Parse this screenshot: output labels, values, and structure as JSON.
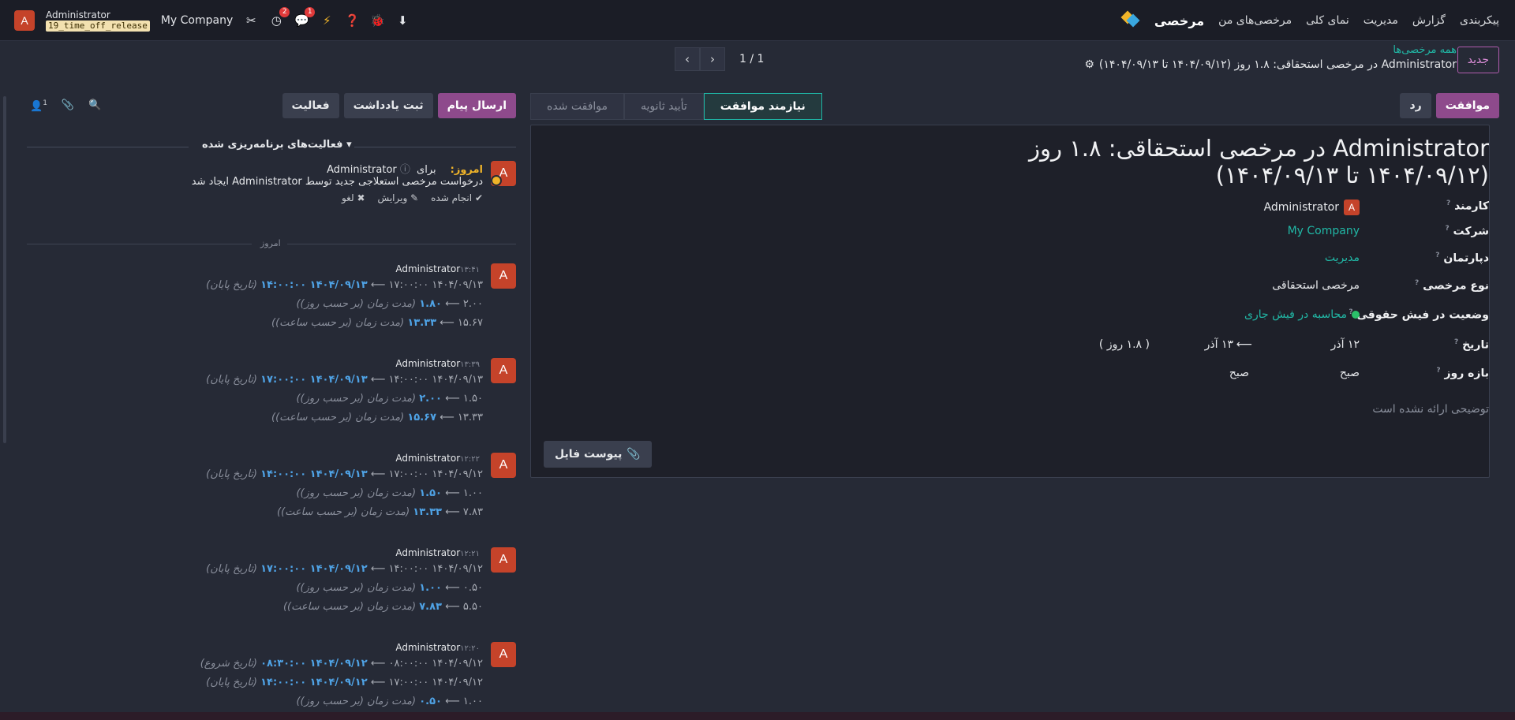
{
  "navbar": {
    "app_name": "مرخصی",
    "menu": [
      "مرخصی‌های من",
      "نمای کلی",
      "مدیریت",
      "گزارش",
      "پیکربندی"
    ],
    "company": "My Company",
    "user_name": "Administrator",
    "db_name": "19_time_off_release",
    "avatar_letter": "A",
    "activity_badge": "2",
    "chat_badge": "1"
  },
  "control": {
    "new_label": "جدید",
    "breadcrumb_parent": "همه مرخصی‌ها",
    "breadcrumb_current": "Administrator در مرخصی استحقاقی: ۱.۸ روز (۱۴۰۴/۰۹/۱۲ تا ۱۴۰۴/۰۹/۱۳)",
    "pager_value": "1 / 1"
  },
  "status": {
    "approve_label": "موافقت",
    "refuse_label": "رد",
    "stages": [
      {
        "label": "نیازمند موافقت",
        "active": true
      },
      {
        "label": "تأیید ثانویه",
        "active": false
      },
      {
        "label": "موافقت شده",
        "active": false
      }
    ]
  },
  "form": {
    "title": "Administrator در مرخصی استحقاقی: ۱.۸ روز (۱۴۰۴/۰۹/۱۲ تا ۱۴۰۴/۰۹/۱۳)",
    "employee_label": "کارمند",
    "employee_value": "Administrator",
    "company_label": "شرکت",
    "company_value": "My Company",
    "department_label": "دپارتمان",
    "department_value": "مدیریت",
    "leave_type_label": "نوع مرخصی",
    "leave_type_value": "مرخصی استحقاقی",
    "payslip_label": "وضعیت در فیش حقوقی",
    "payslip_value": "محاسبه در فیش جاری",
    "date_label": "تاریخ",
    "date_from": "۱۲ آذر",
    "date_to": "۱۳ آذر",
    "duration": "( ۱.۸ روز )",
    "day_range_label": "بازه روز",
    "day_from": "صبح",
    "day_to": "صبح",
    "description_placeholder": "توضیحی ارائه نشده است",
    "attach_label": "پیوست فایل"
  },
  "chatter": {
    "send_message": "ارسال پیام",
    "log_note": "ثبت یادداشت",
    "activity": "فعالیت",
    "followers_count": "1",
    "scheduled_title": "فعالیت‌های برنامه‌ریزی شده",
    "activity_today": "امروز:",
    "activity_for": "برای Administrator",
    "activity_summary": "درخواست مرخصی استعلاجی جدید توسط Administrator ایجاد شد",
    "done_label": "انجام شده",
    "edit_label": "ویرایش",
    "cancel_label": "لغو",
    "today_separator": "امروز",
    "messages": [
      {
        "author": "Administrator",
        "time": "۱۳:۴۱",
        "changes": [
          {
            "old": "۱۴۰۴/۰۹/۱۳ ۱۷:۰۰:۰۰",
            "new": "۱۴۰۴/۰۹/۱۳ ۱۴:۰۰:۰۰",
            "field": "(تاریخ پایان)"
          },
          {
            "old": "۲.۰۰",
            "new": "۱.۸۰",
            "field": "(مدت زمان (بر حسب روز))"
          },
          {
            "old": "۱۵.۶۷",
            "new": "۱۳.۳۳",
            "field": "(مدت زمان (بر حسب ساعت))"
          }
        ]
      },
      {
        "author": "Administrator",
        "time": "۱۳:۳۹",
        "changes": [
          {
            "old": "۱۴۰۴/۰۹/۱۳ ۱۴:۰۰:۰۰",
            "new": "۱۴۰۴/۰۹/۱۳ ۱۷:۰۰:۰۰",
            "field": "(تاریخ پایان)"
          },
          {
            "old": "۱.۵۰",
            "new": "۲.۰۰",
            "field": "(مدت زمان (بر حسب روز))"
          },
          {
            "old": "۱۳.۳۳",
            "new": "۱۵.۶۷",
            "field": "(مدت زمان (بر حسب ساعت))"
          }
        ]
      },
      {
        "author": "Administrator",
        "time": "۱۲:۲۲",
        "changes": [
          {
            "old": "۱۴۰۴/۰۹/۱۲ ۱۷:۰۰:۰۰",
            "new": "۱۴۰۴/۰۹/۱۳ ۱۴:۰۰:۰۰",
            "field": "(تاریخ پایان)"
          },
          {
            "old": "۱.۰۰",
            "new": "۱.۵۰",
            "field": "(مدت زمان (بر حسب روز))"
          },
          {
            "old": "۷.۸۳",
            "new": "۱۳.۳۳",
            "field": "(مدت زمان (بر حسب ساعت))"
          }
        ]
      },
      {
        "author": "Administrator",
        "time": "۱۲:۲۱",
        "changes": [
          {
            "old": "۱۴۰۴/۰۹/۱۲ ۱۴:۰۰:۰۰",
            "new": "۱۴۰۴/۰۹/۱۲ ۱۷:۰۰:۰۰",
            "field": "(تاریخ پایان)"
          },
          {
            "old": "۰.۵۰",
            "new": "۱.۰۰",
            "field": "(مدت زمان (بر حسب روز))"
          },
          {
            "old": "۵.۵۰",
            "new": "۷.۸۳",
            "field": "(مدت زمان (بر حسب ساعت))"
          }
        ]
      },
      {
        "author": "Administrator",
        "time": "۱۲:۲۰",
        "changes": [
          {
            "old": "۱۴۰۴/۰۹/۱۲ ۰۸:۰۰:۰۰",
            "new": "۱۴۰۴/۰۹/۱۲ ۰۸:۳۰:۰۰",
            "field": "(تاریخ شروع)"
          },
          {
            "old": "۱۴۰۴/۰۹/۱۲ ۱۷:۰۰:۰۰",
            "new": "۱۴۰۴/۰۹/۱۲ ۱۴:۰۰:۰۰",
            "field": "(تاریخ پایان)"
          },
          {
            "old": "۱.۰۰",
            "new": "۰.۵۰",
            "field": "(مدت زمان (بر حسب روز))"
          },
          {
            "old": "۷.۸۳",
            "new": "۵.۵۰",
            "field": "(مدت زمان (بر حسب ساعت))"
          }
        ]
      }
    ]
  },
  "colors": {
    "accent": "#8e4a8c",
    "teal": "#21b8a6",
    "new_value": "#4fa3e6"
  }
}
